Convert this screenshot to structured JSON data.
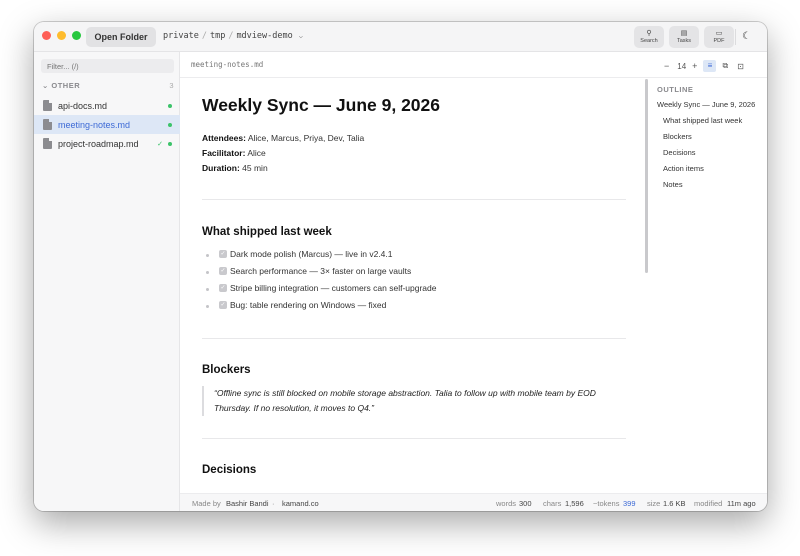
{
  "toolbar": {
    "open_folder": "Open Folder",
    "breadcrumb": [
      "private",
      "tmp",
      "mdview-demo"
    ],
    "buttons": [
      {
        "icon": "search-icon",
        "label": "Search"
      },
      {
        "icon": "tasks-icon",
        "label": "Tasks"
      },
      {
        "icon": "pdf-icon",
        "label": "PDF"
      }
    ],
    "theme_icon": "moon-icon"
  },
  "sidebar": {
    "filter_placeholder": "Filter... (/)",
    "group": "OTHER",
    "group_count": "3",
    "files": [
      {
        "name": "api-docs.md",
        "status": "dot"
      },
      {
        "name": "meeting-notes.md",
        "status": "dot",
        "active": true
      },
      {
        "name": "project-roadmap.md",
        "status": "check-dot"
      }
    ]
  },
  "editor": {
    "file_name": "meeting-notes.md",
    "zoom_minus": "−",
    "zoom_level": "14",
    "zoom_plus": "+"
  },
  "document": {
    "title": "Weekly Sync — June 9, 2026",
    "meta": [
      {
        "label": "Attendees:",
        "value": "Alice, Marcus, Priya, Dev, Talia"
      },
      {
        "label": "Facilitator:",
        "value": "Alice"
      },
      {
        "label": "Duration:",
        "value": "45 min"
      }
    ],
    "shipped_heading": "What shipped last week",
    "tasks": [
      "Dark mode polish (Marcus) — live in v2.4.1",
      "Search performance — 3× faster on large vaults",
      "Stripe billing integration — customers can self-upgrade",
      "Bug: table rendering on Windows — fixed"
    ],
    "blockers_heading": "Blockers",
    "blocker_quote": "“Offline sync is still blocked on mobile storage abstraction. Talia to follow up with mobile team by EOD Thursday. If no resolution, it moves to Q4.”",
    "decisions_heading": "Decisions"
  },
  "outline": {
    "heading": "OUTLINE",
    "items": [
      "Weekly Sync — June 9, 2026",
      "What shipped last week",
      "Blockers",
      "Decisions",
      "Action items",
      "Notes"
    ]
  },
  "footer": {
    "made_by_label": "Made by",
    "author": "Bashir Bandi",
    "separator": "·",
    "site": "kamand.co",
    "words_label": "words",
    "words": "300",
    "chars_label": "chars",
    "chars": "1,596",
    "tokens_label": "~tokens",
    "tokens": "399",
    "size_label": "size",
    "size": "1.6 KB",
    "modified_label": "modified",
    "modified": "11m ago"
  },
  "colors": {
    "accent": "#3d6ad6",
    "traffic_red": "#fe5f57",
    "traffic_yellow": "#febc2e",
    "traffic_green": "#28c840",
    "status_green": "#3cc36a"
  }
}
